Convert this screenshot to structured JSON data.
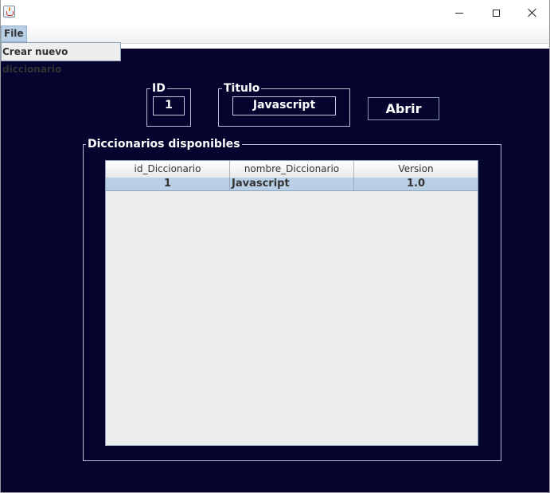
{
  "window": {
    "icon": "java-cup-icon",
    "controls": {
      "minimize_icon": "minimize-icon",
      "maximize_icon": "maximize-icon",
      "close_icon": "close-icon"
    }
  },
  "menubar": {
    "file_label": "File",
    "dropdown_items": [
      "Crear nuevo diccionario"
    ]
  },
  "form": {
    "id_label": "ID",
    "id_value": "1",
    "titulo_label": "Titulo",
    "titulo_value": "Javascript",
    "open_button_label": "Abrir"
  },
  "dictionaries_panel": {
    "title": "Diccionarios disponibles",
    "columns": [
      "id_Diccionario",
      "nombre_Diccionario",
      "Version"
    ],
    "rows": [
      {
        "id": "1",
        "name": "Javascript",
        "version": "1.0",
        "selected": true
      }
    ]
  },
  "colors": {
    "background": "#04042f",
    "selection": "#b8cfe5",
    "table_background": "#eeeeee"
  }
}
